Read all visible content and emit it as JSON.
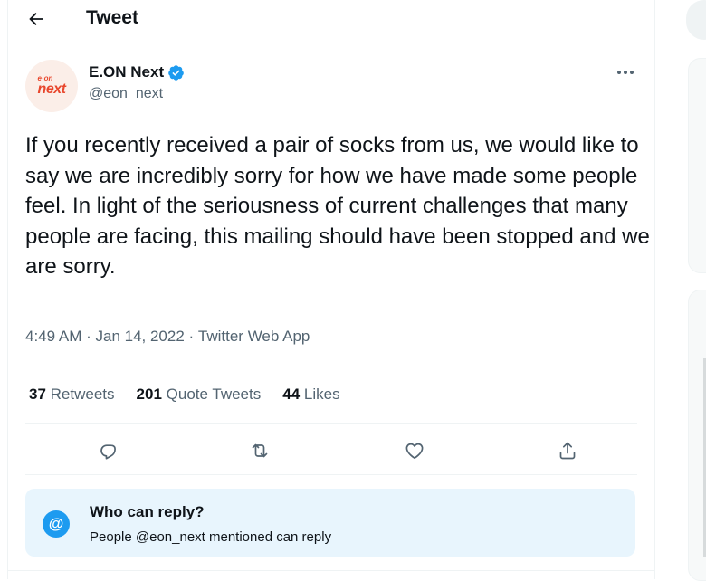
{
  "header": {
    "title": "Tweet"
  },
  "author": {
    "name": "E.ON Next",
    "handle": "@eon_next",
    "avatar_text_small": "e·on",
    "avatar_text_large": "next",
    "brand_color": "#e8472d",
    "verified": true
  },
  "tweet": {
    "text": "If you recently received a pair of socks from us, we would like to say we are incredibly sorry for how we have made some people feel. In light of the seriousness of current challenges that many people are facing, this mailing should have been stopped and we are sorry.",
    "time": "4:49 AM",
    "date": "Jan 14, 2022",
    "source": "Twitter Web App",
    "separator": " · "
  },
  "stats": {
    "retweets": {
      "count": "37",
      "label": "Retweets"
    },
    "quote_tweets": {
      "count": "201",
      "label": "Quote Tweets"
    },
    "likes": {
      "count": "44",
      "label": "Likes"
    }
  },
  "actions": {
    "icons": [
      "reply-icon",
      "retweet-icon",
      "like-icon",
      "share-icon"
    ]
  },
  "reply_settings": {
    "icon_text": "@",
    "title": "Who can reply?",
    "subtitle": "People @eon_next mentioned can reply"
  },
  "colors": {
    "accent": "#1d9bf0",
    "secondary_text": "#536471",
    "reply_box_bg": "#e8f5fd"
  }
}
